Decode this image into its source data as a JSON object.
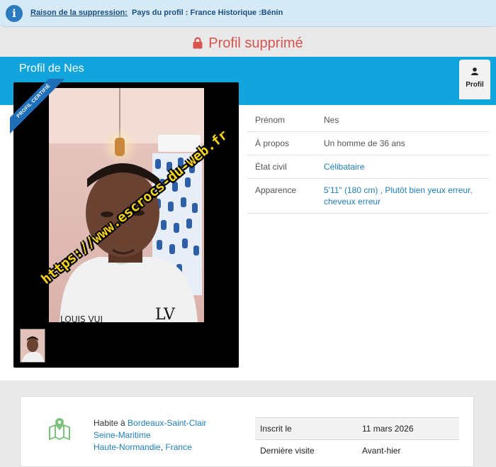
{
  "notice": {
    "icon": "info-icon",
    "label": "Raison de la suppression:",
    "value": "Pays du profil : France Historique :Bénin"
  },
  "status": {
    "icon": "lock-icon",
    "text": "Profil supprimé",
    "color": "#d9534f"
  },
  "header": {
    "title": "Profil de Nes",
    "tab_icon": "user-icon",
    "tab_label": "Profil",
    "color": "#12a4dc"
  },
  "photo": {
    "ribbon": "PROFIL CERTIFIÉ",
    "watermark": "https://www.escrocs-du-web.fr"
  },
  "details": [
    {
      "key": "Prénom",
      "value": "Nes",
      "link": false
    },
    {
      "key": "À propos",
      "value": "Un homme de 36 ans",
      "link": false
    },
    {
      "key": "État civil",
      "value": "Célibataire",
      "link": true
    },
    {
      "key": "Apparence",
      "value": "5'11\" (180 cm) , Plutôt bien yeux erreur, cheveux erreur",
      "link": true
    }
  ],
  "location": {
    "icon": "map-icon",
    "prefix": "Habite à",
    "city": "Bordeaux-Saint-Clair",
    "department": "Seine-Maritime",
    "region": "Haute-Normandie",
    "country": "France"
  },
  "activity": [
    {
      "key": "Inscrit le",
      "value": "11 mars 2026"
    },
    {
      "key": "Dernière visite",
      "value": "Avant-hier"
    }
  ]
}
